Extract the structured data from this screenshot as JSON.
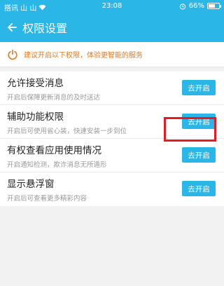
{
  "status_bar": {
    "left_text": "搭讯 山 山",
    "time": "23:08",
    "battery_percent": "66%",
    "battery_level": 0.66
  },
  "header": {
    "title": "权限设置"
  },
  "notice": {
    "text": "建议开启以下权限，体验更智能的服务",
    "icon": "power-icon"
  },
  "permissions": [
    {
      "title": "允许接受消息",
      "desc": "开启后保障更新消息的及时送达",
      "button": "去开启"
    },
    {
      "title": "辅助功能权限",
      "desc": "开启后可使用省心装，快速安装一步到位",
      "button": "去开启"
    },
    {
      "title": "有权查看应用使用情况",
      "desc": "开启通知检测，欺诈消息无所遁形",
      "button": "去开启"
    },
    {
      "title": "显示悬浮窗",
      "desc": "开启后可查看更多精彩内容",
      "button": "去开启"
    }
  ],
  "colors": {
    "accent": "#2bb6e8",
    "notice_text": "#e07a1f",
    "highlight": "#e21b25"
  }
}
